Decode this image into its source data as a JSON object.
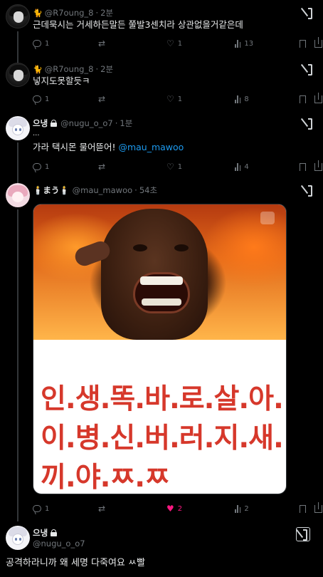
{
  "tweets": [
    {
      "header": {
        "emoji": "🐈",
        "handle": "@R7oung_8",
        "time": "2분"
      },
      "text": "근데묵시는 거세하든말든 쭐발3센치라 상관없을거같은데",
      "stats": {
        "replies": "1",
        "likes": "1",
        "views": "13"
      }
    },
    {
      "header": {
        "emoji": "🐈",
        "handle": "@R7oung_8",
        "time": "2분"
      },
      "text": "넣지도못할듯ㅋ",
      "stats": {
        "replies": "1",
        "likes": "1",
        "views": "8"
      }
    },
    {
      "header": {
        "name": "으냉",
        "handle": "@nugu_o_o7",
        "time": "1분"
      },
      "text_line1": "...",
      "text_line2": "가라 택시몬 물어뜯어! ",
      "mention": "@mau_mawoo",
      "stats": {
        "replies": "1",
        "likes": "1",
        "views": "4"
      }
    },
    {
      "header": {
        "name": "🕯️まう🕯️",
        "handle": "@mau_mawoo",
        "time": "54초"
      },
      "media_caption_lines": [
        "인.생.똑.바.로.살.아.",
        "이.병.신.버.러.지.새.",
        "끼.야.ㅉ.ㅉ"
      ],
      "stats": {
        "replies": "1",
        "likes": "2",
        "views": "2"
      }
    }
  ],
  "main_tweet": {
    "name": "으냉",
    "handle": "@nugu_o_o7",
    "text": "공격하라니까 왜 세명 다죽여요 ㅆ빨"
  },
  "icons": {
    "reply": "reply-icon",
    "retweet": "retweet-icon",
    "like": "heart-icon",
    "views": "views-bars-icon",
    "bookmark": "bookmark-icon",
    "share": "share-icon",
    "grok": "grok-icon"
  },
  "colors": {
    "background": "#000000",
    "text": "#e7e9ea",
    "muted": "#71767b",
    "mention": "#1d9bf0",
    "liked": "#f91880",
    "caption_red": "#d6382b"
  }
}
